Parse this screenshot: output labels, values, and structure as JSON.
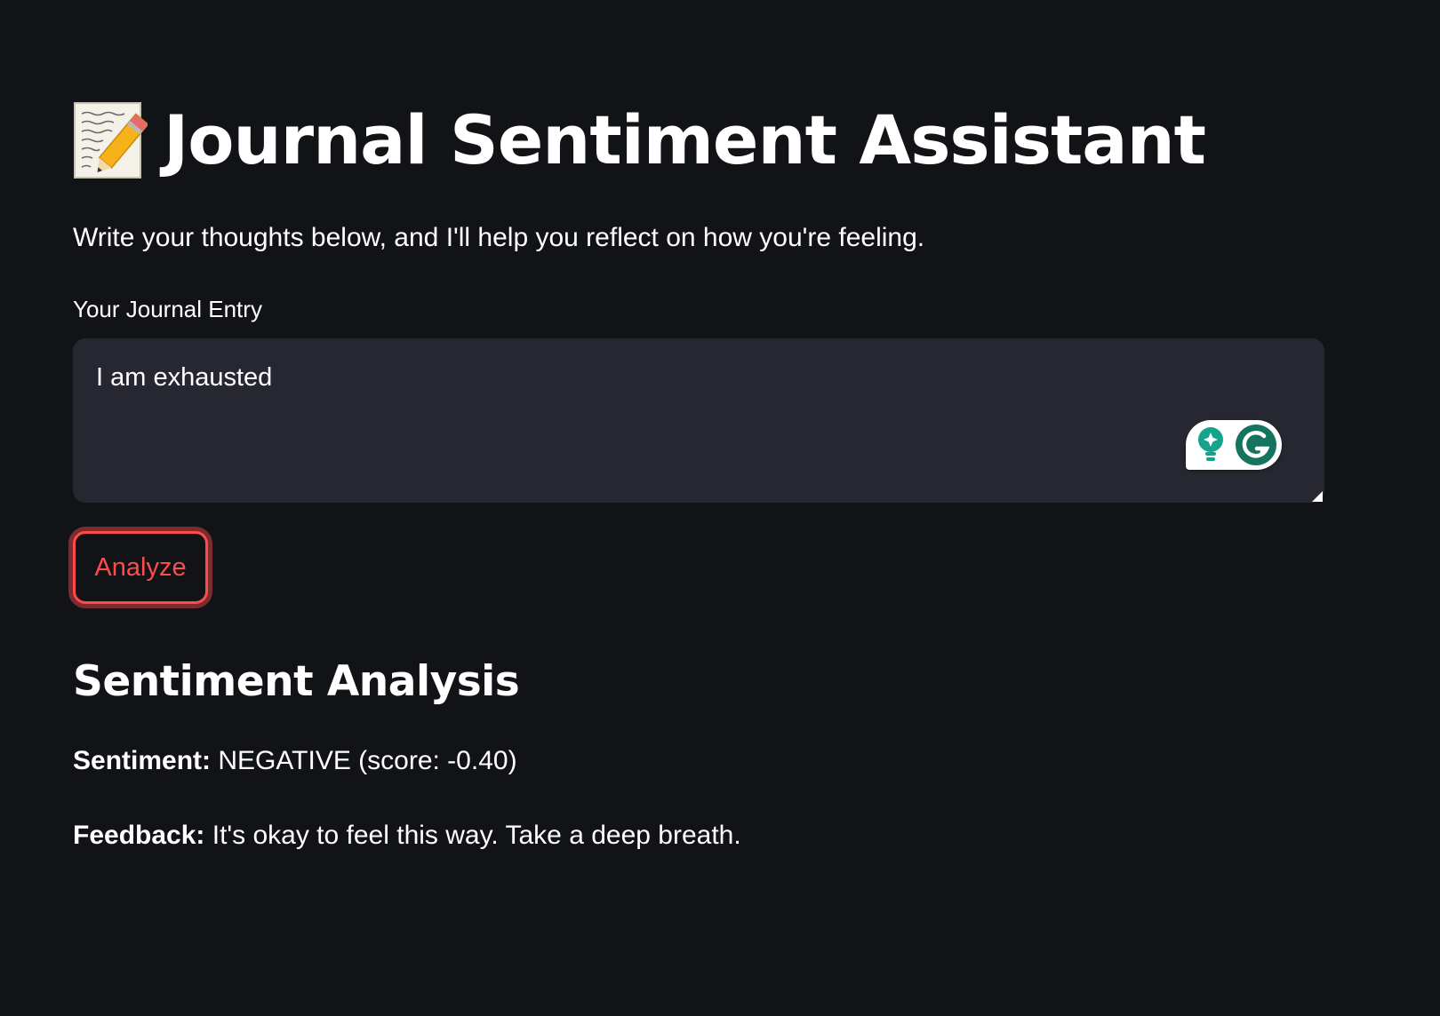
{
  "colors": {
    "background": "#111317",
    "input_background": "#262730",
    "accent": "#ff4b4b",
    "text": "#ffffff",
    "grammarly_green": "#15745e"
  },
  "header": {
    "icon": "memo-icon",
    "title": "Journal Sentiment Assistant",
    "subtitle": "Write your thoughts below, and I'll help you reflect on how you're feeling."
  },
  "journal_input": {
    "label": "Your Journal Entry",
    "value": "I am exhausted",
    "extension_icon": "grammarly-icon"
  },
  "analyze_button": {
    "label": "Analyze"
  },
  "results": {
    "heading": "Sentiment Analysis",
    "sentiment_label": "Sentiment:",
    "sentiment_value": "NEGATIVE (score: -0.40)",
    "feedback_label": "Feedback:",
    "feedback_value": "It's okay to feel this way. Take a deep breath."
  }
}
